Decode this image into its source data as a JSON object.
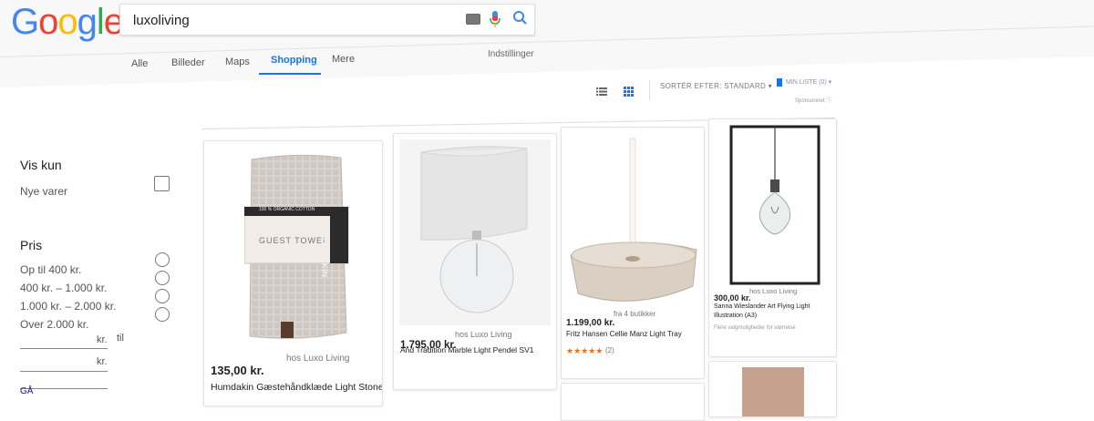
{
  "logo": [
    "G",
    "o",
    "o",
    "g",
    "l",
    "e"
  ],
  "search": {
    "value": "luxoliving"
  },
  "tabs": [
    {
      "label": "Alle",
      "active": false
    },
    {
      "label": "Billeder",
      "active": false
    },
    {
      "label": "Maps",
      "active": false
    },
    {
      "label": "Shopping",
      "active": true
    },
    {
      "label": "Mere",
      "active": false
    }
  ],
  "settings_label": "Indstillinger",
  "toolbar": {
    "sort_label": "SORTÉR EFTER: STANDARD ▾",
    "my_list_label": "MIN LISTE (0) ▾",
    "sponsored_label": "Sponsoreret ⓘ"
  },
  "sidebar": {
    "filter_heading": "Vis kun",
    "new_items": "Nye varer",
    "price_heading": "Pris",
    "price_options": [
      "Op til 400 kr.",
      "400 kr. – 1.000 kr.",
      "1.000 kr. – 2.000 kr.",
      "Over 2.000 kr."
    ],
    "range_unit": "kr.",
    "range_to": "til",
    "go_label": "GÅ"
  },
  "products": [
    {
      "price": "135,00 kr.",
      "seller": "hos Luxo Living",
      "title": "Humdakin Gæstehåndklæde Light Stone"
    },
    {
      "price": "1.795,00 kr.",
      "seller": "hos Luxo Living",
      "title": "And Tradition Marble Light Pendel SV1"
    },
    {
      "price": "1.199,00 kr.",
      "seller": "fra 4 butikker",
      "title": "Fritz Hansen Cellie Manz Light Tray",
      "stars": "★★★★★",
      "reviews": "(2)"
    },
    {
      "price": "300,00 kr.",
      "seller": "hos Luxo Living",
      "title": "Sanna Wieslander Art Flying Light",
      "title2": "Illustration (A3)",
      "note": "Flere valgmuligheder for størrelse"
    }
  ],
  "towel_brand": "HUMDAKIN",
  "towel_label_title": "GUEST TOWEL",
  "towel_label_top": "100 % ORGANIC COTTON",
  "colors": {
    "accent": "#1a73e8",
    "star": "#e7711b",
    "link": "#1a0dab"
  }
}
